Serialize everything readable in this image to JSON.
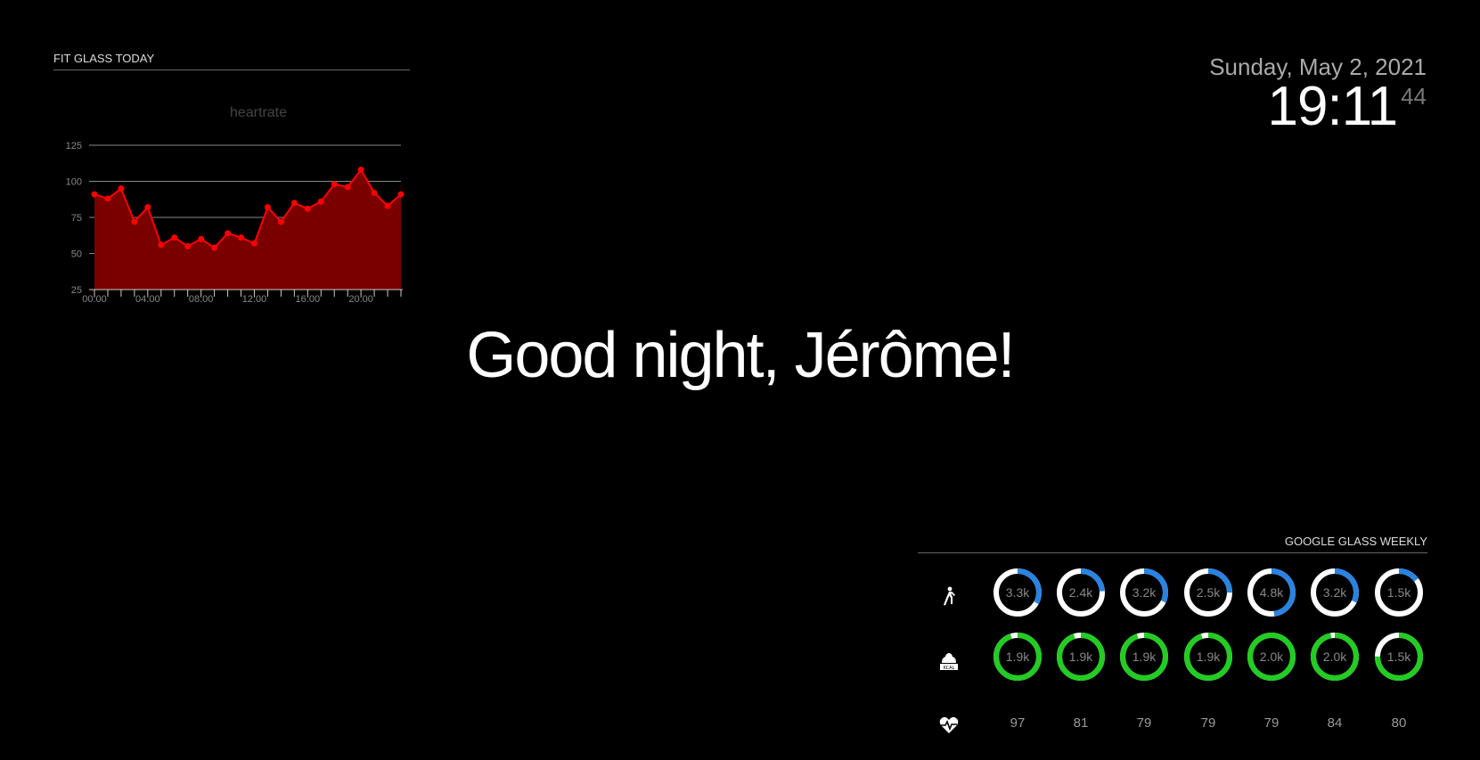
{
  "fit_today": {
    "header": "FIT GLASS TODAY",
    "chart_data": {
      "type": "area",
      "title": "heartrate",
      "x_ticks": [
        "00:00",
        "04:00",
        "08:00",
        "12:00",
        "16:00",
        "20:00"
      ],
      "y_ticks": [
        25,
        50,
        75,
        100,
        125
      ],
      "ylim": [
        25,
        125
      ],
      "xlim_hours": [
        0,
        23
      ],
      "x_hours": [
        0,
        1,
        2,
        3,
        4,
        5,
        6,
        7,
        8,
        9,
        10,
        11,
        12,
        13,
        14,
        15,
        16,
        17,
        18,
        19,
        20,
        21,
        22,
        23
      ],
      "values": [
        91,
        88,
        95,
        72,
        82,
        56,
        61,
        55,
        60,
        54,
        64,
        61,
        57,
        82,
        72,
        85,
        81,
        86,
        98,
        96,
        108,
        92,
        83,
        91
      ],
      "grid": true,
      "colors": {
        "fill": "#7a0000",
        "line": "#ff0000",
        "point": "#ff0000",
        "grid": "#888888",
        "title": "#444444"
      }
    }
  },
  "clock": {
    "date": "Sunday, May 2, 2021",
    "time": "19:11",
    "seconds": "44"
  },
  "compliment": "Good night, Jérôme!",
  "weekly": {
    "header": "GOOGLE GLASS WEEKLY",
    "icons": [
      "walking-icon",
      "calories-icon",
      "heart-icon"
    ],
    "steps": {
      "color": "#2a83e0",
      "labels": [
        "3.3k",
        "2.4k",
        "3.2k",
        "2.5k",
        "4.8k",
        "3.2k",
        "1.5k"
      ],
      "fractions": [
        0.33,
        0.24,
        0.32,
        0.25,
        0.48,
        0.32,
        0.15
      ]
    },
    "calories": {
      "color": "#22cc22",
      "labels": [
        "1.9k",
        "1.9k",
        "1.9k",
        "1.9k",
        "2.0k",
        "2.0k",
        "1.5k"
      ],
      "fractions": [
        0.95,
        0.95,
        0.95,
        0.95,
        1.0,
        0.97,
        0.75
      ]
    },
    "heartrate": [
      "97",
      "81",
      "79",
      "79",
      "79",
      "84",
      "80"
    ]
  }
}
